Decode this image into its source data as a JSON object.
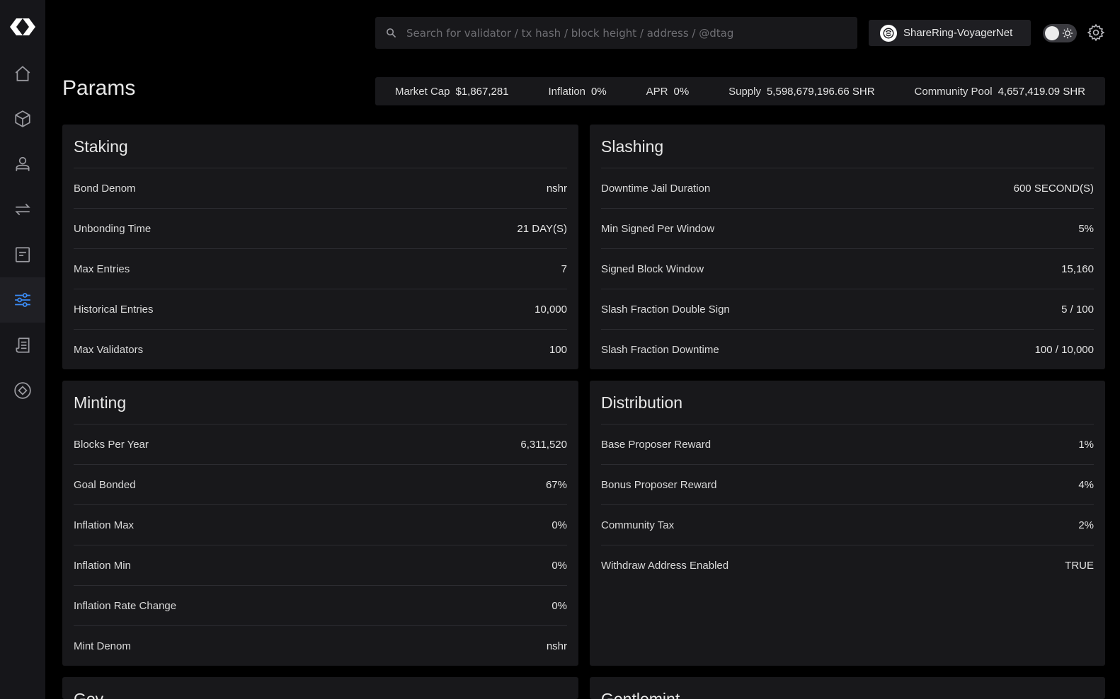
{
  "search": {
    "placeholder": "Search for validator / tx hash / block height / address / @dtag"
  },
  "network": {
    "label": "ShareRing-VoyagerNet"
  },
  "page": {
    "title": "Params"
  },
  "stats": [
    {
      "label": "Market Cap",
      "value": "$1,867,281"
    },
    {
      "label": "Inflation",
      "value": "0%"
    },
    {
      "label": "APR",
      "value": "0%"
    },
    {
      "label": "Supply",
      "value": "5,598,679,196.66 SHR"
    },
    {
      "label": "Community Pool",
      "value": "4,657,419.09 SHR"
    }
  ],
  "staking": {
    "title": "Staking",
    "rows": [
      {
        "label": "Bond Denom",
        "value": "nshr"
      },
      {
        "label": "Unbonding Time",
        "value": "21 DAY(S)"
      },
      {
        "label": "Max Entries",
        "value": "7"
      },
      {
        "label": "Historical Entries",
        "value": "10,000"
      },
      {
        "label": "Max Validators",
        "value": "100"
      }
    ]
  },
  "slashing": {
    "title": "Slashing",
    "rows": [
      {
        "label": "Downtime Jail Duration",
        "value": "600 SECOND(S)"
      },
      {
        "label": "Min Signed Per Window",
        "value": "5%"
      },
      {
        "label": "Signed Block Window",
        "value": "15,160"
      },
      {
        "label": "Slash Fraction Double Sign",
        "value": "5 / 100"
      },
      {
        "label": "Slash Fraction Downtime",
        "value": "100 / 10,000"
      }
    ]
  },
  "minting": {
    "title": "Minting",
    "rows": [
      {
        "label": "Blocks Per Year",
        "value": "6,311,520"
      },
      {
        "label": "Goal Bonded",
        "value": "67%"
      },
      {
        "label": "Inflation Max",
        "value": "0%"
      },
      {
        "label": "Inflation Min",
        "value": "0%"
      },
      {
        "label": "Inflation Rate Change",
        "value": "0%"
      },
      {
        "label": "Mint Denom",
        "value": "nshr"
      }
    ]
  },
  "distribution": {
    "title": "Distribution",
    "rows": [
      {
        "label": "Base Proposer Reward",
        "value": "1%"
      },
      {
        "label": "Bonus Proposer Reward",
        "value": "4%"
      },
      {
        "label": "Community Tax",
        "value": "2%"
      },
      {
        "label": "Withdraw Address Enabled",
        "value": "TRUE"
      }
    ]
  },
  "gov": {
    "title": "Gov"
  },
  "gentlemint": {
    "title": "Gentlemint"
  },
  "icons": {
    "logo": "sharering-logo",
    "nav": [
      "home-icon",
      "blocks-icon",
      "validators-icon",
      "transactions-icon",
      "proposals-icon",
      "params-icon",
      "documents-icon",
      "shareledger-icon"
    ],
    "active_nav": "params-icon"
  },
  "colors": {
    "accent": "#3b8bf5",
    "background": "#000000",
    "card": "#18181b"
  }
}
